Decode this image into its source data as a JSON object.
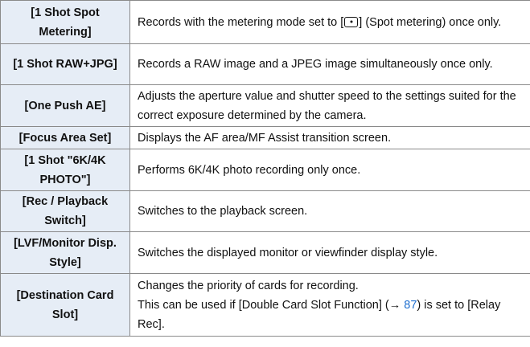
{
  "rows": [
    {
      "name": "[1 Shot Spot Metering]",
      "desc_before": "Records with the metering mode set to [",
      "desc_icon": "spot-metering-icon",
      "desc_after": "] (Spot metering) once only."
    },
    {
      "name": "[1 Shot RAW+JPG]",
      "desc": "Records a RAW image and a JPEG image simultaneously once only."
    },
    {
      "name": "[One Push AE]",
      "desc": "Adjusts the aperture value and shutter speed to the settings suited for the correct exposure determined by the camera."
    },
    {
      "name": "[Focus Area Set]",
      "desc": "Displays the AF area/MF Assist transition screen."
    },
    {
      "name": "[1 Shot \"6K/4K PHOTO\"]",
      "desc": "Performs 6K/4K photo recording only once."
    },
    {
      "name": "[Rec / Playback Switch]",
      "desc": "Switches to the playback screen."
    },
    {
      "name": "[LVF/Monitor Disp. Style]",
      "desc": "Switches the displayed monitor or viewfinder display style."
    },
    {
      "name": "[Destination Card Slot]",
      "desc_line1": "Changes the priority of cards for recording.",
      "desc_line2_before": "This can be used if [Double Card Slot Function] (→ ",
      "desc_line2_link": "87",
      "desc_line2_after": ") is set to [Relay Rec]."
    }
  ],
  "colors": {
    "name_cell_bg": "#e6edf6",
    "border": "#8a8a8a",
    "link": "#1f6fd0"
  }
}
